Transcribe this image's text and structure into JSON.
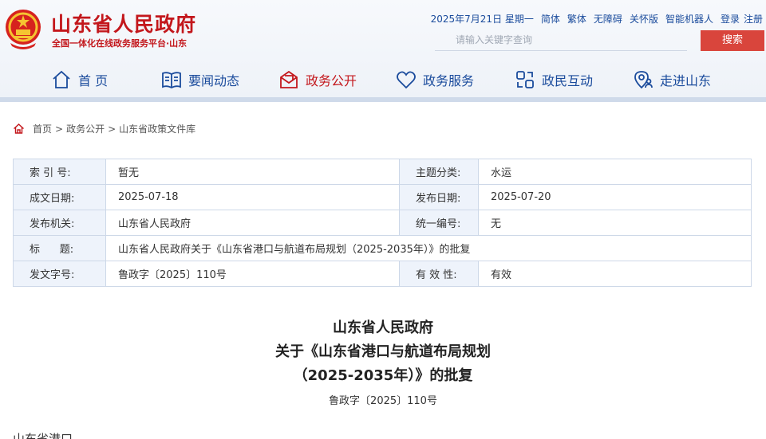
{
  "header": {
    "site_title": "山东省人民政府",
    "site_subtitle": "全国一体化在线政务服务平台·山东",
    "date": "2025年7月21日 星期一",
    "links": [
      "简体",
      "繁体",
      "无障碍",
      "关怀版",
      "智能机器人",
      "登录",
      "注册"
    ],
    "search_placeholder": "请输入关键字查询",
    "search_button": "搜索"
  },
  "nav": {
    "items": [
      {
        "label": "首 页",
        "icon": "home-icon"
      },
      {
        "label": "要闻动态",
        "icon": "book-icon"
      },
      {
        "label": "政务公开",
        "icon": "mail-open-icon",
        "active": true
      },
      {
        "label": "政务服务",
        "icon": "heart-icon"
      },
      {
        "label": "政民互动",
        "icon": "interaction-icon"
      },
      {
        "label": "走进山东",
        "icon": "location-person-icon"
      }
    ]
  },
  "breadcrumb": {
    "items": [
      "首页",
      "政务公开",
      "山东省政策文件库"
    ],
    "separator": ">"
  },
  "meta": {
    "index_label": "索 引 号:",
    "index_value": "暂无",
    "topic_label": "主题分类:",
    "topic_value": "水运",
    "written_label": "成文日期:",
    "written_value": "2025-07-18",
    "publish_label": "发布日期:",
    "publish_value": "2025-07-20",
    "issuer_label": "发布机关:",
    "issuer_value": "山东省人民政府",
    "serial_label": "统一编号:",
    "serial_value": "无",
    "title_label": "标      题:",
    "title_value": "山东省人民政府关于《山东省港口与航道布局规划（2025-2035年）》的批复",
    "docno_label": "发文字号:",
    "docno_value": "鲁政字〔2025〕110号",
    "validity_label": "有 效 性:",
    "validity_value": "有效"
  },
  "document": {
    "title_line1": "山东省人民政府",
    "title_line2": "关于《山东省港口与航道布局规划",
    "title_line3": "（2025-2035年）》的批复",
    "doc_number": "鲁政字〔2025〕110号",
    "body_start": "山东省港口"
  },
  "colors": {
    "brand_red": "#c3171c",
    "nav_blue": "#1a4b9c",
    "search_button": "#d9453c",
    "label_bg": "#eef3fb"
  }
}
